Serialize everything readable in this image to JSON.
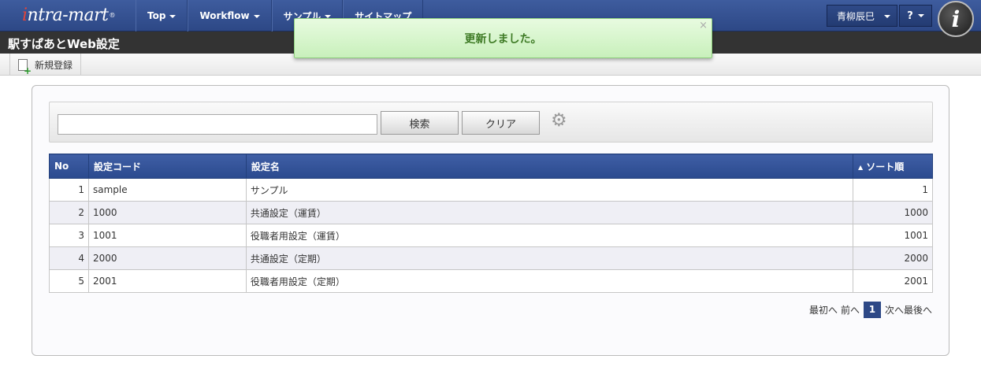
{
  "logo": {
    "text_i": "i",
    "text_rest": "ntra-mart",
    "reg": "®"
  },
  "nav": [
    {
      "label": "Top"
    },
    {
      "label": "Workflow"
    },
    {
      "label": "サンプル"
    },
    {
      "label": "サイトマップ"
    }
  ],
  "user": {
    "name": "青柳辰巳"
  },
  "help": {
    "label": "?"
  },
  "brand": {
    "glyph": "i"
  },
  "page": {
    "title": "駅すぱあとWeb設定"
  },
  "toolbar": {
    "new_label": "新規登録"
  },
  "notification": {
    "message": "更新しました。",
    "close": "×"
  },
  "search": {
    "value": "",
    "search_label": "検索",
    "clear_label": "クリア"
  },
  "table": {
    "headers": {
      "no": "No",
      "code": "設定コード",
      "name": "設定名",
      "sort": "ソート順"
    },
    "sort_indicator": "▲",
    "rows": [
      {
        "no": "1",
        "code": "sample",
        "name": "サンプル",
        "sort": "1"
      },
      {
        "no": "2",
        "code": "1000",
        "name": "共通設定（運賃）",
        "sort": "1000"
      },
      {
        "no": "3",
        "code": "1001",
        "name": "役職者用設定（運賃）",
        "sort": "1001"
      },
      {
        "no": "4",
        "code": "2000",
        "name": "共通設定（定期）",
        "sort": "2000"
      },
      {
        "no": "5",
        "code": "2001",
        "name": "役職者用設定（定期）",
        "sort": "2001"
      }
    ]
  },
  "pager": {
    "first": "最初へ",
    "prev": "前へ",
    "current": "1",
    "next": "次へ",
    "last": "最後へ"
  },
  "colors": {
    "nav_blue": "#2d4886",
    "title_bar": "#333333",
    "notify_bg": "#d8f5cc",
    "notify_text": "#3d7a24",
    "table_header": "#2f4e94"
  }
}
